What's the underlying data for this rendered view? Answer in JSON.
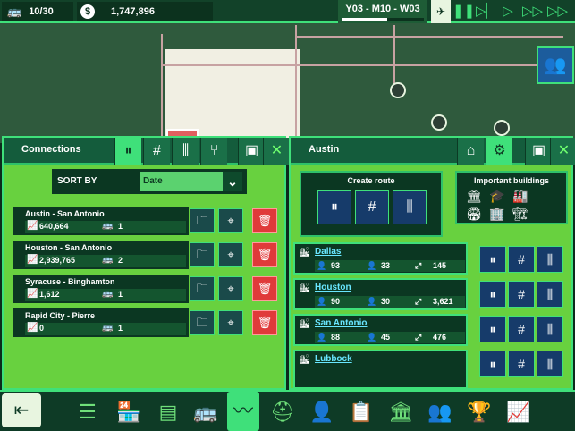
{
  "topbar": {
    "vehicles": "10/30",
    "money_icon": "$",
    "money": "1,747,896",
    "date": "Y03 - M10 - W03",
    "speed_icons": [
      "pause-icon",
      "slow-icon",
      "play-icon",
      "fast-icon",
      "fastest-icon"
    ]
  },
  "connections_panel": {
    "title": "Connections",
    "sort_label": "SORT BY",
    "sort_value": "Date",
    "items": [
      {
        "name": "Austin - San Antonio",
        "passengers": "640,664",
        "vehicles": "1"
      },
      {
        "name": "Houston - San Antonio",
        "passengers": "2,939,765",
        "vehicles": "2"
      },
      {
        "name": "Syracuse - Binghamton",
        "passengers": "1,612",
        "vehicles": "1"
      },
      {
        "name": "Rapid City - Pierre",
        "passengers": "0",
        "vehicles": "1"
      }
    ]
  },
  "city_panel": {
    "title": "Austin",
    "create_route_title": "Create route",
    "important_buildings_title": "Important buildings",
    "cities": [
      {
        "name": "Dallas",
        "a": "93",
        "b": "33",
        "c": "145"
      },
      {
        "name": "Houston",
        "a": "90",
        "b": "30",
        "c": "3,621"
      },
      {
        "name": "San Antonio",
        "a": "88",
        "b": "45",
        "c": "476"
      },
      {
        "name": "Lubbock",
        "a": "",
        "b": "",
        "c": ""
      }
    ]
  },
  "colors": {
    "accent": "#3fe07a",
    "panel_bg": "#68d13f",
    "dark": "#0b3722",
    "delete": "#e03a3a"
  }
}
